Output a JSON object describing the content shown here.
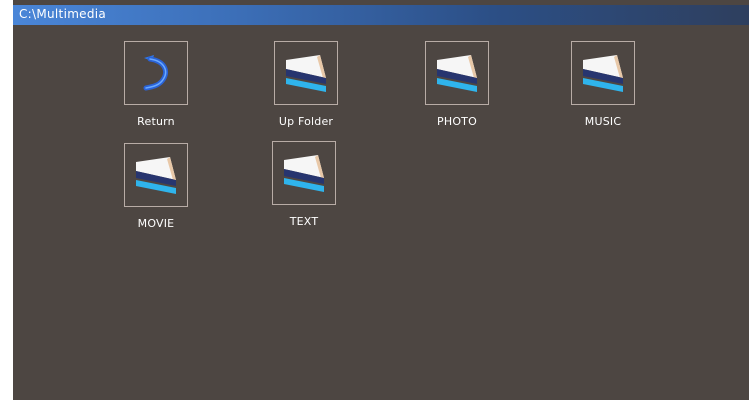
{
  "window": {
    "path": "C:\\Multimedia"
  },
  "items": [
    {
      "label": "Return",
      "icon": "return-arrow-icon"
    },
    {
      "label": "Up Folder",
      "icon": "folder-icon"
    },
    {
      "label": "PHOTO",
      "icon": "folder-icon"
    },
    {
      "label": "MUSIC",
      "icon": "folder-icon"
    },
    {
      "label": "MOVIE",
      "icon": "folder-icon"
    },
    {
      "label": "TEXT",
      "icon": "folder-icon"
    }
  ],
  "colors": {
    "background": "#4d4642",
    "title_bar_start": "#4a86d8",
    "title_bar_end": "#2e3f5e",
    "frame_border": "#b8aca6",
    "folder_navy": "#27356f",
    "folder_cyan": "#2fb4ec",
    "return_arrow": "#2a6fe0"
  }
}
